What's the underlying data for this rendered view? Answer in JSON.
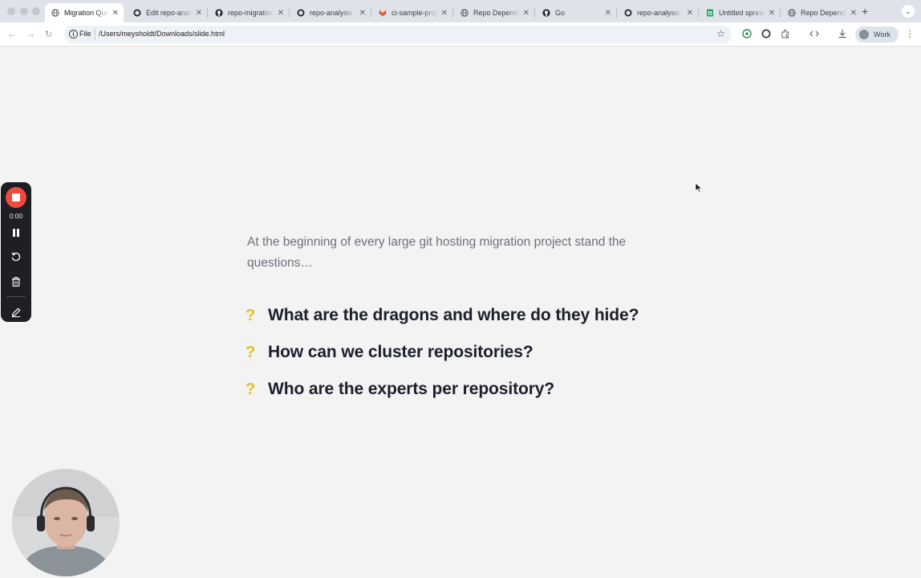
{
  "browser": {
    "tabs": [
      {
        "title": "Migration Questions",
        "favicon": "globe-icon",
        "active": true
      },
      {
        "title": "Edit repo-analysis",
        "favicon": "ring-icon",
        "active": false
      },
      {
        "title": "repo-migration",
        "favicon": "github-icon",
        "active": false
      },
      {
        "title": "repo-analysis",
        "favicon": "ring-icon",
        "active": false
      },
      {
        "title": "ci-sample-project",
        "favicon": "gitlab-icon",
        "active": false
      },
      {
        "title": "Repo Dependencies",
        "favicon": "globe-icon",
        "active": false
      },
      {
        "title": "Go",
        "favicon": "github-icon",
        "active": false
      },
      {
        "title": "repo-analysis",
        "favicon": "ring-icon",
        "active": false
      },
      {
        "title": "Untitled spreadsheet",
        "favicon": "sheets-icon",
        "active": false
      },
      {
        "title": "Repo Dependencies",
        "favicon": "globe-icon",
        "active": false
      }
    ],
    "address": {
      "scheme_label": "File",
      "url": "/Users/meysholdt/Downloads/slide.html"
    },
    "profile_label": "Work"
  },
  "recorder": {
    "timer": "0:00",
    "stop_color": "#ef4a3d"
  },
  "slide": {
    "intro": "At the beginning of every large git hosting migration project stand the questions…",
    "question_mark": "?",
    "questions": [
      "What are the dragons and where do they hide?",
      "How can we cluster repositories?",
      "Who are the experts per repository?"
    ],
    "accent_color": "#e4bf2a"
  }
}
